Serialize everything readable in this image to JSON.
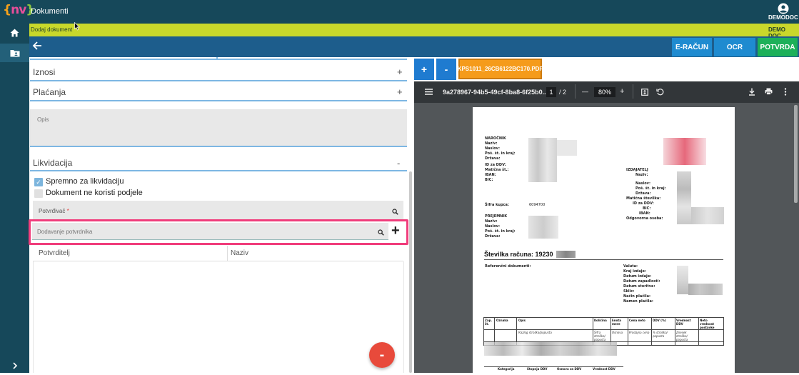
{
  "app": {
    "title": "Dokumenti",
    "user": "DEMODOC"
  },
  "subheader": {
    "left_label": "Dodaj dokument",
    "right_label": "DEMO DOC"
  },
  "toolbar": {
    "e_racun_label": "E-RAČUN",
    "ocr_label": "OCR",
    "potvrda_label": "POTVRDA"
  },
  "colors": {
    "topbar": "#16485a",
    "yellowbar": "#c9d82b",
    "bluebar": "#1d5d8c",
    "button_blue": "#1f8bd0",
    "button_green": "#1db059",
    "highlight": "#f03c7b",
    "fab": "#e84a3b",
    "file_tab": "#f59b1b"
  },
  "sections": {
    "iznosi": "Iznosi",
    "placanja": "Plaćanja",
    "opis_label": "Opis",
    "likvidacija": "Likvidacija",
    "plus": "+",
    "minus": "-"
  },
  "likvidacija": {
    "checkbox1_label": "Spremno za likvidaciju",
    "checkbox1_checked": true,
    "checkbox2_label": "Dokument ne koristi podjele",
    "checkbox2_checked": false,
    "potvrdivac_label": "Potvrđivač",
    "required_mark": "*",
    "dodavanje_placeholder": "Dodavanje potvrdnika",
    "add_symbol": "+",
    "table_headers": [
      "Potvrditelj",
      "Naziv"
    ]
  },
  "fab_label": "-",
  "viewer": {
    "tab_plus": "+",
    "tab_minus": "-",
    "file_tab": "KPS1011_26CB6122BC170.PDF",
    "filename": "9a278967-94b5-49cf-8ba8-6f25b0...",
    "current_page": "1",
    "page_count": "/ 2",
    "zoom_out": "—",
    "zoom": "80%",
    "zoom_in": "+"
  },
  "invoice": {
    "narocnik_title": "NAROČNIK",
    "narocnik_fields": [
      "Naziv:",
      "Naslov:",
      "Poš. št. in kraj:",
      "Država:",
      "ID za DDV:",
      "Matična št.:",
      "IBAN:",
      "BIC:"
    ],
    "sifra_kupca_label": "Šifra kupca:",
    "sifra_kupca_value": "6094700",
    "prejemnik_title": "PREJEMNIK",
    "prejemnik_fields": [
      "Naziv:",
      "Naslov:",
      "Poš. št. in kraj:",
      "Država:"
    ],
    "izdajatelj_title": "IZDAJATELJ",
    "izdajatelj_fields": [
      "Naziv:",
      "",
      "Naslov:",
      "Poš. št. in kraj:",
      "Država:",
      "Matična številka:",
      "ID za DDV:",
      "BIC:",
      "IBAN:",
      "Odgovorna oseba:"
    ],
    "stevilka_racuna": "Številka računa: 19230",
    "referencni": "Referenčni dokumenti:",
    "right_fields": [
      "Valuta:",
      "Kraj izdaje:",
      "Datum izdaje:",
      "Datum zapadlosti:",
      "Datum storitve:",
      "Sklic:",
      "Način plačila:",
      "Namen plačila:"
    ],
    "table_headers": [
      "Zap. št.",
      "Oznaka",
      "Opis",
      "Količina",
      "Enota mere",
      "Cena neto",
      "DDV (%)",
      "Vrednost DDV",
      "Neto vrednost postavke"
    ],
    "table_italic_row": [
      "Razlog stroška/popusta",
      "Šifra stroška/ popusta",
      "Osnova",
      "Prodajna cena",
      "% stroška/ popusta",
      "Znesek stroška/ popusta"
    ],
    "summary_headers": [
      "Kategorija",
      "Stopnja DDV",
      "Osnova za DDV",
      "Vrednost DDV"
    ]
  }
}
